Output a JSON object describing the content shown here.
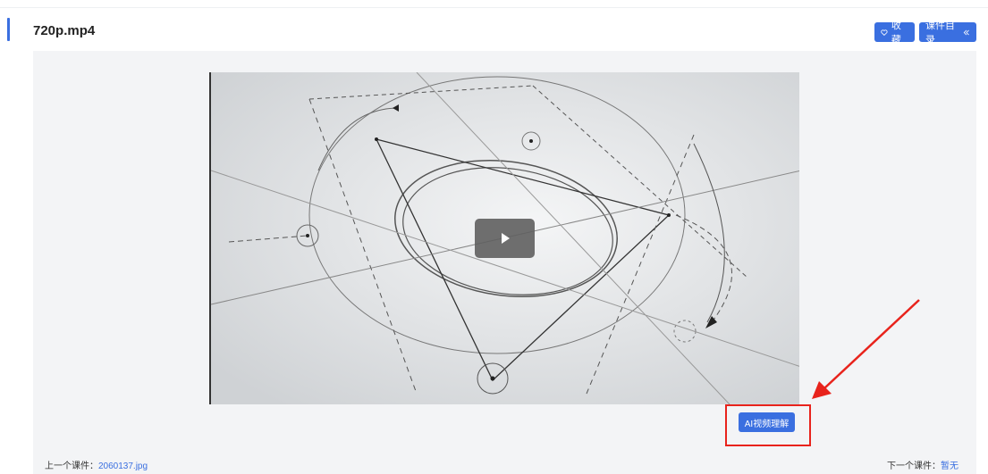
{
  "header": {
    "title": "720p.mp4",
    "favorite_label": "收藏",
    "catalog_label": "课件目录",
    "favorite_icon": "heart-icon",
    "catalog_icon": "double-chevron-left-icon"
  },
  "video": {
    "play_icon": "play-icon"
  },
  "ai": {
    "button_label": "AI视频理解"
  },
  "nav": {
    "prev_label": "上一个课件：",
    "prev_value": "2060137.jpg",
    "next_label": "下一个课件：",
    "next_value": "暂无"
  },
  "colors": {
    "accent": "#3a6fe0",
    "highlight": "#e8231c",
    "content_bg": "#f3f4f6"
  }
}
